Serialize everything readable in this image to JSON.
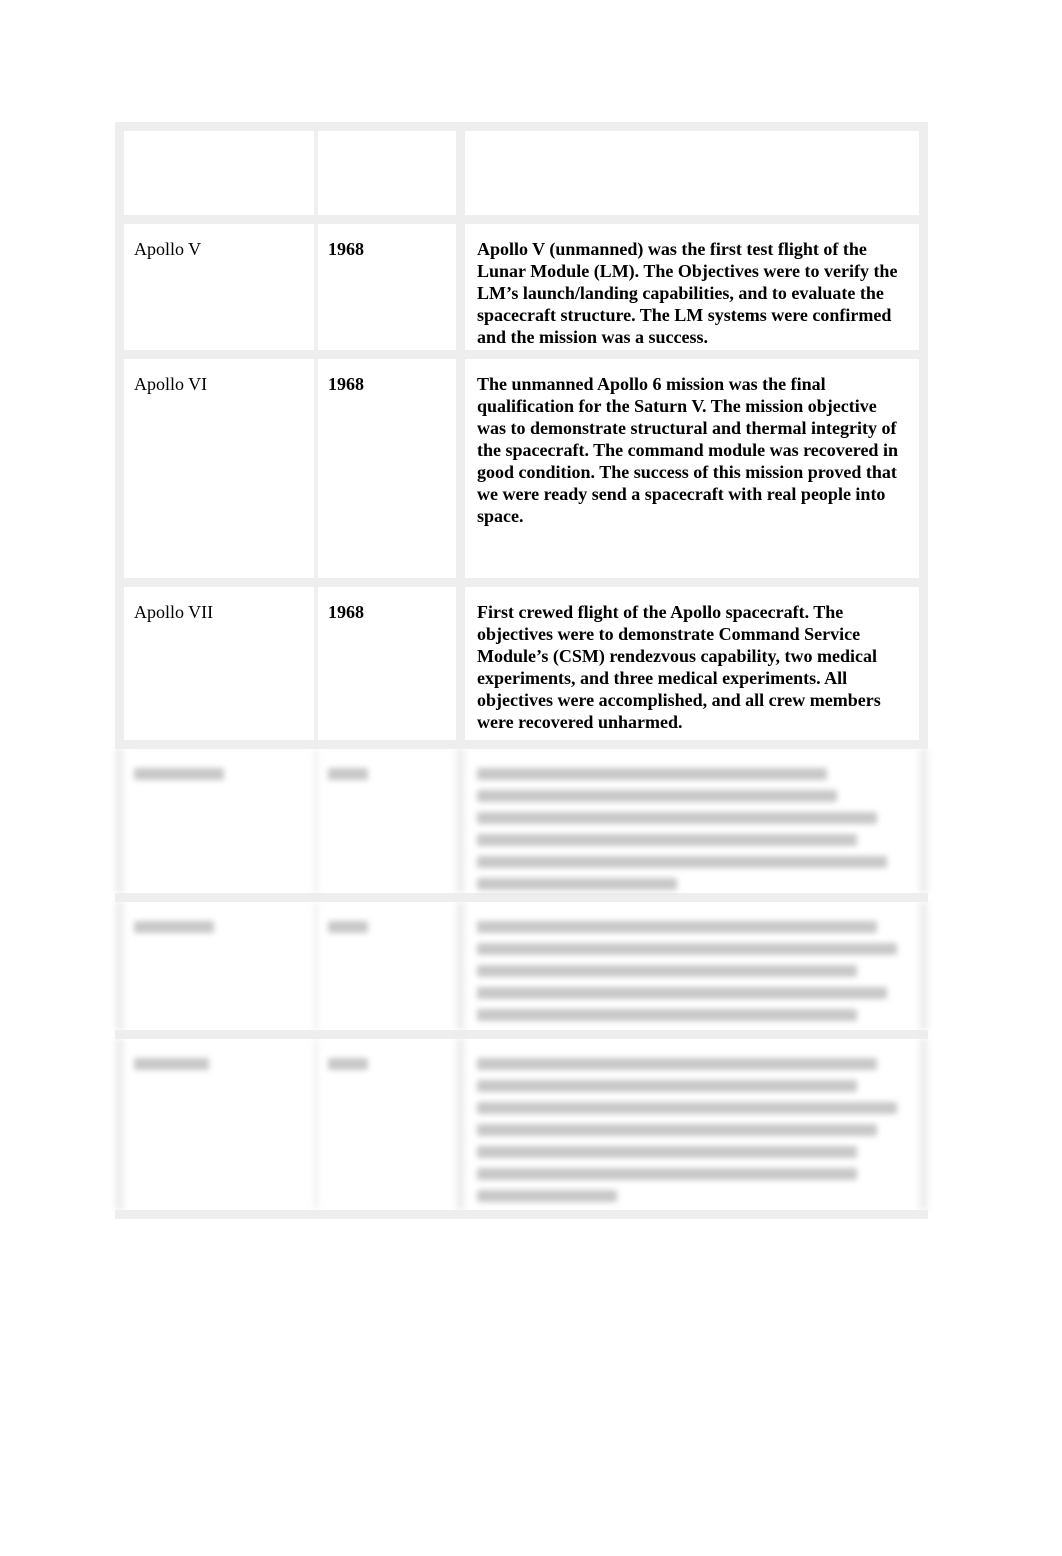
{
  "table": {
    "rows": [
      {
        "name": "",
        "year": "",
        "description": ""
      },
      {
        "name": "Apollo V",
        "year": "1968",
        "description": "Apollo V (unmanned) was the first test flight of the Lunar Module (LM).  The Objectives were to verify the LM’s launch/landing capabilities, and to evaluate the spacecraft structure.  The LM systems were confirmed and the mission was a success."
      },
      {
        "name": "Apollo VI",
        "year": "1968",
        "description": "The unmanned Apollo 6 mission was the final qualification for the Saturn V.  The mission objective was to demonstrate structural and thermal integrity of the spacecraft.  The command module was recovered in good condition.  The success of this mission proved that we were ready send a spacecraft with real people into space."
      },
      {
        "name": "Apollo VII",
        "year": "1968",
        "description": "First crewed flight of the Apollo spacecraft.  The objectives were to demonstrate Command Service Module’s (CSM) rendezvous capability, two medical experiments, and three medical experiments.  All objectives were accomplished, and all crew members were recovered unharmed."
      }
    ],
    "blurred_rows": 3
  }
}
